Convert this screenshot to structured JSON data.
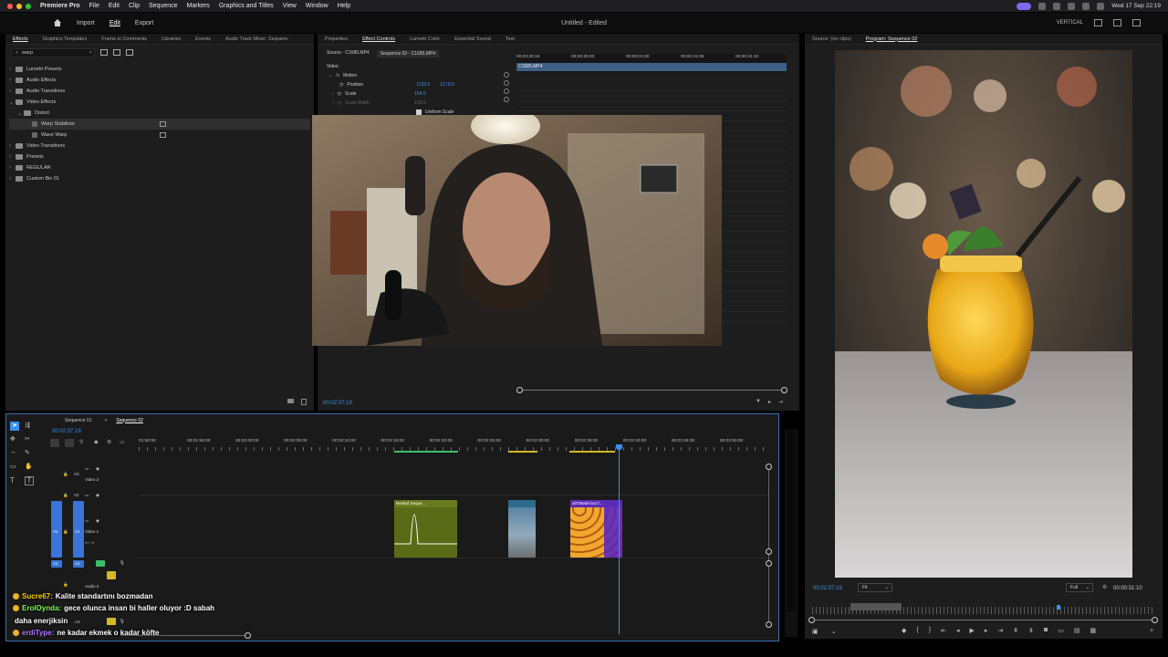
{
  "menubar": {
    "app": "Premiere Pro",
    "items": [
      "File",
      "Edit",
      "Clip",
      "Sequence",
      "Markers",
      "Graphics and Titles",
      "View",
      "Window",
      "Help"
    ],
    "clock": "Wed 17 Sep  22:19"
  },
  "appbar": {
    "import": "Import",
    "edit": "Edit",
    "export": "Export",
    "title": "Untitled - Edited",
    "vertical_label": "VERTICAL"
  },
  "left_panel": {
    "tabs": [
      "Effects",
      "Graphics Templates",
      "Frame.io Comments",
      "Libraries",
      "Events",
      "Audio Track Mixer: Sequenc"
    ],
    "search_value": "warp",
    "tree": [
      {
        "label": "Lumetri Presets",
        "indent": 0,
        "open": false
      },
      {
        "label": "Audio Effects",
        "indent": 0,
        "open": false
      },
      {
        "label": "Audio Transitions",
        "indent": 0,
        "open": false
      },
      {
        "label": "Video Effects",
        "indent": 0,
        "open": true
      },
      {
        "label": "Distort",
        "indent": 1,
        "open": true
      },
      {
        "label": "Warp Stabilizer",
        "indent": 2,
        "leaf": true,
        "selected": true
      },
      {
        "label": "Wave Warp",
        "indent": 2,
        "leaf": true
      },
      {
        "label": "Video Transitions",
        "indent": 0,
        "open": false
      },
      {
        "label": "Presets",
        "indent": 0,
        "open": false
      },
      {
        "label": "REGULAR",
        "indent": 0,
        "open": false
      },
      {
        "label": "Custom Bin 01",
        "indent": 0,
        "open": false
      }
    ]
  },
  "effect_controls": {
    "tabs": [
      "Properties",
      "Effect Controls",
      "Lumetri Color",
      "Essential Sound",
      "Text"
    ],
    "source_tab": "Source · C1685.MP4",
    "seq_tab": "Sequence 02 · C1685.MP4",
    "video_header": "Video",
    "motion": "Motion",
    "position_label": "Position",
    "position_x": "1129.0",
    "position_y": "2179.0",
    "scale_label": "Scale",
    "scale_value": "154.0",
    "scale_width_label": "Scale Width",
    "scale_width_value": "100.0",
    "uniform_scale": "Uniform Scale",
    "mini_clip": "C1685.MP4",
    "mini_ruler": [
      "00;00;30;15",
      "00;00;30;20",
      "00;00;31;00",
      "00;00;31;05",
      "00;00;31;10"
    ],
    "timecode": "00:02:37:19"
  },
  "source_panel": {
    "tabs": [
      "Source: (no clips)",
      "Program: Sequence 02"
    ]
  },
  "program": {
    "timecode": "00:02:37:19",
    "fit": "Fit",
    "full": "Full",
    "duration": "00:00:31:10"
  },
  "timeline": {
    "tabs": [
      "Sequence 01",
      "Sequence 02"
    ],
    "timecode": "00:02:37:19",
    "ruler": [
      "01:50:00",
      "00:01:55:00",
      "00:02:00:00",
      "00:02:05:00",
      "00:02:10:00",
      "00:02:15:00",
      "00:02:20:00",
      "00:02:25:00",
      "00:02:30:00",
      "00:02:35:00",
      "00:02:40:00",
      "00:02:45:00",
      "00:02:50:00"
    ],
    "tracks": {
      "v3": "V3",
      "v3_name": "Video 3",
      "v2": "V2",
      "v1": "V1",
      "v1_name": "Video 1",
      "a1": "A1",
      "a2_name": "Audio 2",
      "a3": "A3"
    },
    "clips": [
      {
        "name": "Nested Seque...",
        "color": "#5b6a16"
      },
      {
        "name": "",
        "color": "#7799bb"
      },
      {
        "name": "af705eb6-bcc7...",
        "color": "#e69a28"
      }
    ]
  },
  "chat": [
    {
      "user": "Sucre67:",
      "user_color": "#ffd400",
      "text": "Kalite standartını bozmadan"
    },
    {
      "user": "ErolOynda:",
      "user_color": "#7cff4d",
      "text": "gece olunca insan bi haller oluyor :D sabah"
    },
    {
      "user": "",
      "user_color": "#ffffff",
      "text": "daha enerjiksin"
    },
    {
      "user": "erdiType:",
      "user_color": "#b07bff",
      "text": "ne kadar ekmek o kadar köfte"
    }
  ],
  "colors": {
    "accent": "#3c8ff0",
    "panel_bg": "#1d1d1d",
    "track_blue": "#3a74d8"
  }
}
